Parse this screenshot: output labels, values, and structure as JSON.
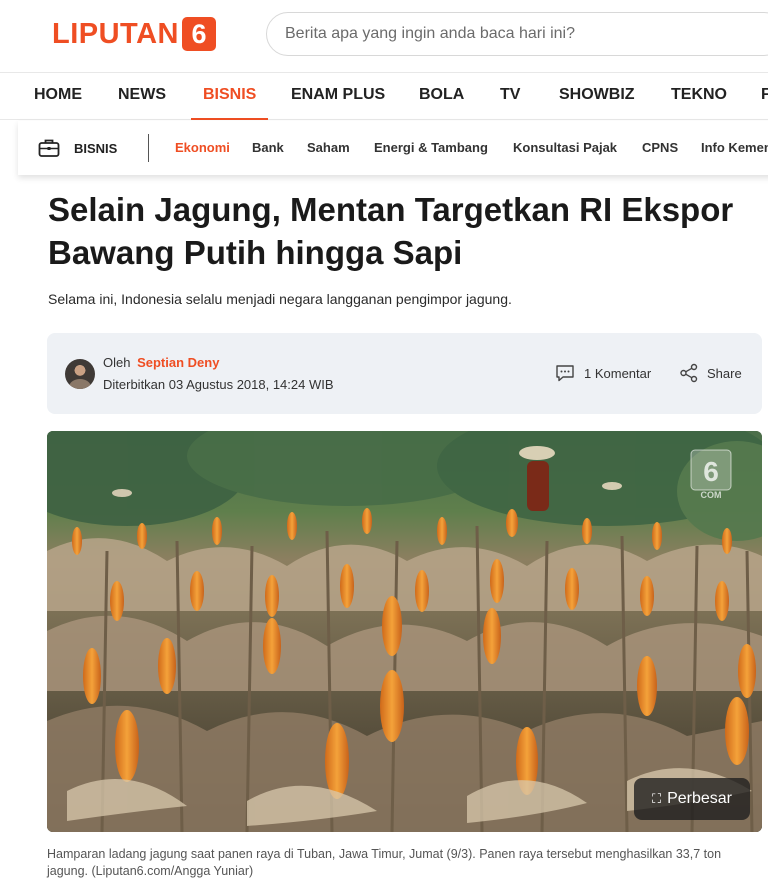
{
  "header": {
    "logo_text": "LIPUTAN",
    "logo_number": "6",
    "search_placeholder": "Berita apa yang ingin anda baca hari ini?"
  },
  "main_nav": {
    "items": [
      "HOME",
      "NEWS",
      "BISNIS",
      "ENAM PLUS",
      "BOLA",
      "TV",
      "SHOWBIZ",
      "TEKNO",
      "F"
    ],
    "active": "BISNIS"
  },
  "sub_nav": {
    "category": "BISNIS",
    "items": [
      "Ekonomi",
      "Bank",
      "Saham",
      "Energi & Tambang",
      "Konsultasi Pajak",
      "CPNS",
      "Info Kemen"
    ],
    "active": "Ekonomi"
  },
  "article": {
    "title": "Selain Jagung, Mentan Targetkan RI Ekspor Bawang Putih hingga Sapi",
    "lead": "Selama ini, Indonesia selalu menjadi negara langganan pengimpor jagung.",
    "byline_prefix": "Oleh",
    "author": "Septian Deny",
    "published": "Diterbitkan 03 Agustus 2018, 14:24 WIB",
    "comments": "1 Komentar",
    "share": "Share",
    "enlarge": "Perbesar",
    "caption": "Hamparan ladang jagung saat panen raya di Tuban, Jawa Timur, Jumat (9/3). Panen raya tersebut menghasilkan 33,7 ton jagung. (Liputan6.com/Angga Yuniar)"
  },
  "colors": {
    "brand": "#ef4e23",
    "meta_bg": "#eef1f5"
  }
}
